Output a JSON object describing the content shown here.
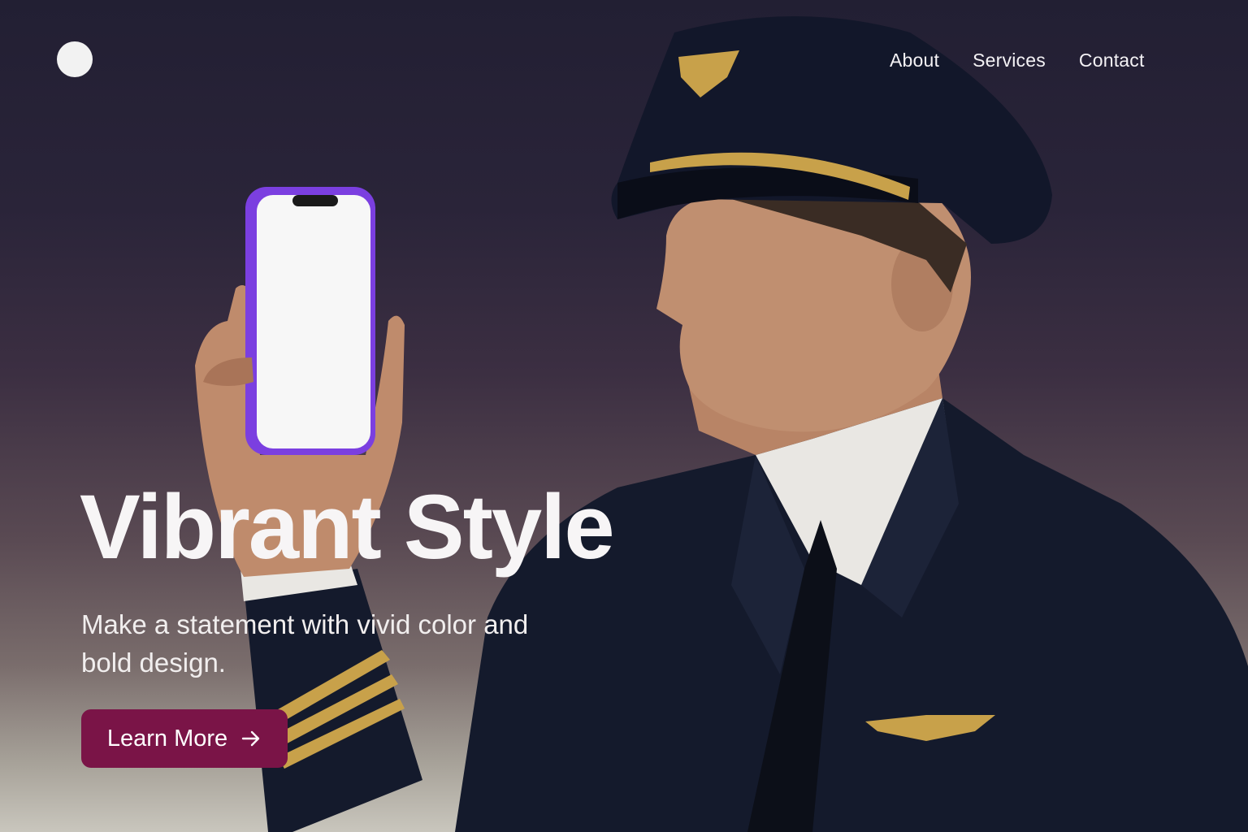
{
  "nav": {
    "items": [
      {
        "label": "About"
      },
      {
        "label": "Services"
      },
      {
        "label": "Contact"
      }
    ]
  },
  "hero": {
    "headline": "Vibrant Style",
    "subtitle": "Make a statement with vivid color and bold design.",
    "cta_label": "Learn More",
    "cta_icon": "arrow-right-icon"
  },
  "colors": {
    "cta_background": "#7a1447",
    "phone_frame": "#7b3fe0",
    "uniform": "#141a2c",
    "gold_trim": "#c8a14a",
    "logo_dot": "#f2f2f2"
  }
}
